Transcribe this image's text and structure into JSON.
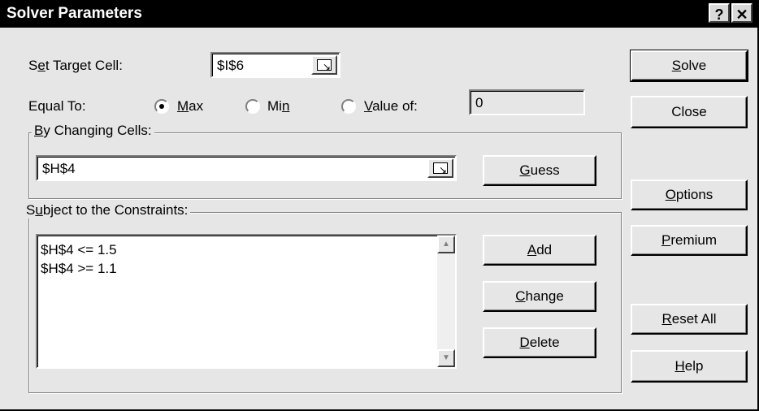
{
  "window": {
    "title": "Solver Parameters",
    "help_glyph": "?",
    "close_glyph": "✕"
  },
  "target": {
    "label_pre": "S",
    "label_u": "e",
    "label_post": "t Target Cell:",
    "value": "$I$6"
  },
  "equal_to": {
    "label": "Equal To:",
    "options": [
      {
        "pre": "",
        "u": "M",
        "post": "ax",
        "selected": true
      },
      {
        "pre": "Mi",
        "u": "n",
        "post": "",
        "selected": false
      },
      {
        "pre": "",
        "u": "V",
        "post": "alue of:",
        "selected": false
      }
    ],
    "value_of": "0"
  },
  "changing": {
    "legend_u": "B",
    "legend_post": "y Changing Cells:",
    "value": "$H$4",
    "guess_u": "G",
    "guess_post": "uess"
  },
  "constraints": {
    "legend_pre": "S",
    "legend_u": "u",
    "legend_post": "bject to the Constraints:",
    "items": [
      "$H$4 <= 1.5",
      "$H$4 >= 1.1"
    ],
    "add_u": "A",
    "add_post": "dd",
    "change_u": "C",
    "change_post": "hange",
    "delete_u": "D",
    "delete_post": "elete"
  },
  "buttons": {
    "solve_u": "S",
    "solve_post": "olve",
    "close": "Close",
    "options_u": "O",
    "options_post": "ptions",
    "premium_u": "P",
    "premium_post": "remium",
    "reset_u": "R",
    "reset_post": "eset All",
    "help_u": "H",
    "help_post": "elp"
  }
}
